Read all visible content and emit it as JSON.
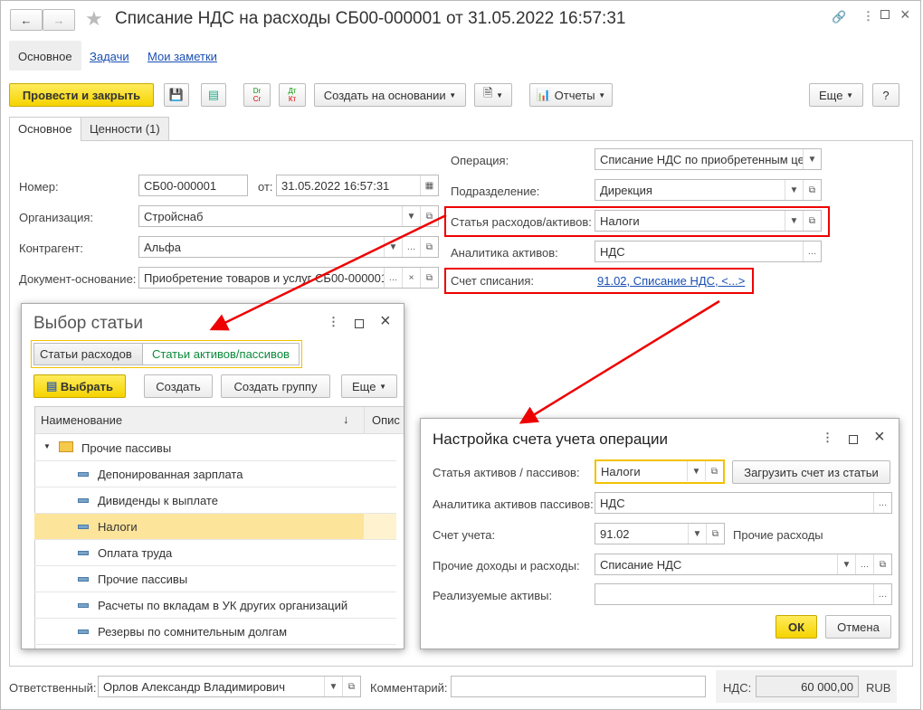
{
  "window": {
    "title": "Списание НДС на расходы СБ00-000001 от 31.05.2022 16:57:31"
  },
  "nav_tabs": [
    "Основное",
    "Задачи",
    "Мои заметки"
  ],
  "toolbar": {
    "post_close": "Провести и закрыть",
    "create_based": "Создать на основании",
    "reports": "Отчеты",
    "more": "Еще",
    "help": "?",
    "dtkt1": "Dr",
    "dtkt2": "Cr",
    "dtkt3": "Дт",
    "dtkt4": "Кт"
  },
  "form_tabs": [
    "Основное",
    "Ценности (1)"
  ],
  "form": {
    "number_label": "Номер:",
    "number": "СБ00-000001",
    "date_label": "от:",
    "date": "31.05.2022 16:57:31",
    "org_label": "Организация:",
    "org": "Стройснаб",
    "counterparty_label": "Контрагент:",
    "counterparty": "Альфа",
    "basis_label": "Документ-основание:",
    "basis": "Приобретение товаров и услуг СБ00-000001",
    "operation_label": "Операция:",
    "operation": "Списание НДС по приобретенным це",
    "division_label": "Подразделение:",
    "division": "Дирекция",
    "article_label": "Статья расходов/активов:",
    "article": "Налоги",
    "analytics_label": "Аналитика активов:",
    "analytics": "НДС",
    "account_label": "Счет списания:",
    "account": "91.02, Списание НДС, <...>"
  },
  "footer": {
    "responsible_label": "Ответственный:",
    "responsible": "Орлов Александр Владимирович",
    "comment_label": "Комментарий:",
    "comment": "",
    "vat_label": "НДС:",
    "vat": "60 000,00",
    "currency": "RUB"
  },
  "dialog_select": {
    "title": "Выбор статьи",
    "tabs": [
      "Статьи расходов",
      "Статьи активов/пассивов"
    ],
    "select": "Выбрать",
    "create": "Создать",
    "create_group": "Создать группу",
    "more": "Еще",
    "columns": [
      "Наименование",
      "Опис"
    ],
    "sort_icon": "↓",
    "group": "Прочие пассивы",
    "items": [
      "Депонированная зарплата",
      "Дивиденды к выплате",
      "Налоги",
      "Оплата труда",
      "Прочие пассивы",
      "Расчеты по вкладам в УК других организаций",
      "Резервы по сомнительным долгам"
    ],
    "selected_index": 2
  },
  "dialog_account": {
    "title": "Настройка счета учета операции",
    "article_label": "Статья активов / пассивов:",
    "article": "Налоги",
    "load_button": "Загрузить счет из статьи",
    "analytics_label": "Аналитика активов пассивов:",
    "analytics": "НДС",
    "account_label": "Счет учета:",
    "account": "91.02",
    "account_name": "Прочие расходы",
    "other_label": "Прочие доходы и расходы:",
    "other": "Списание НДС",
    "assets_label": "Реализуемые активы:",
    "assets": "",
    "ok": "ОК",
    "cancel": "Отмена"
  },
  "colors": {
    "accent_yellow": "#f5d300",
    "highlight": "#e00000",
    "selected_row": "#fde49b",
    "green_tab": "#0a8a3a"
  }
}
